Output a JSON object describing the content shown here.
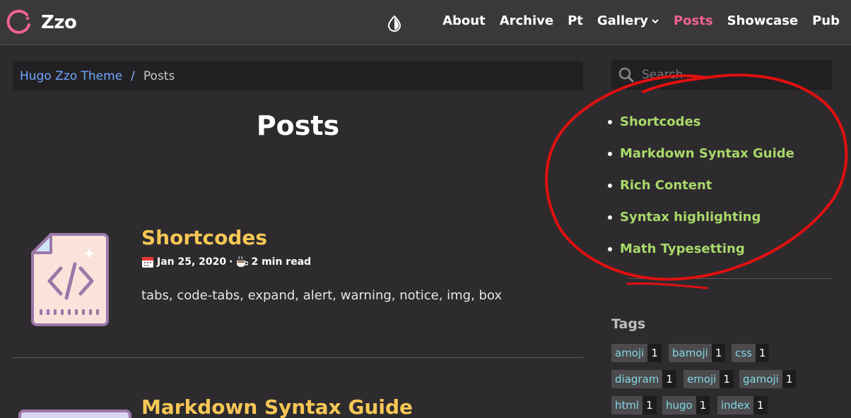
{
  "brand": {
    "name": "Zzo"
  },
  "nav": {
    "items": [
      {
        "label": "About",
        "active": false
      },
      {
        "label": "Archive",
        "active": false
      },
      {
        "label": "Pt",
        "active": false
      },
      {
        "label": "Gallery",
        "active": false,
        "dropdown": true
      },
      {
        "label": "Posts",
        "active": true
      },
      {
        "label": "Showcase",
        "active": false
      },
      {
        "label": "Pub",
        "active": false
      }
    ]
  },
  "breadcrumb": {
    "home": "Hugo Zzo Theme",
    "separator": "/",
    "current": "Posts"
  },
  "page": {
    "title": "Posts"
  },
  "posts": [
    {
      "title": "Shortcodes",
      "date": "Jan 25, 2020",
      "separator": "·",
      "read_time": "2 min read",
      "summary": "tabs, code-tabs, expand, alert, warning, notice, img, box",
      "icon": "code-file-icon"
    },
    {
      "title": "Markdown Syntax Guide",
      "icon": "document-icon"
    }
  ],
  "sidebar": {
    "search": {
      "placeholder": "Search"
    },
    "recent": [
      "Shortcodes",
      "Markdown Syntax Guide",
      "Rich Content",
      "Syntax highlighting",
      "Math Typesetting"
    ],
    "tags_heading": "Tags",
    "tags": [
      {
        "name": "amoji",
        "count": "1"
      },
      {
        "name": "bamoji",
        "count": "1"
      },
      {
        "name": "css",
        "count": "1"
      },
      {
        "name": "diagram",
        "count": "1"
      },
      {
        "name": "emoji",
        "count": "1"
      },
      {
        "name": "gamoji",
        "count": "1"
      },
      {
        "name": "html",
        "count": "1"
      },
      {
        "name": "hugo",
        "count": "1"
      },
      {
        "name": "index",
        "count": "1"
      }
    ]
  },
  "colors": {
    "background": "#2e2b2e",
    "navbar": "#3b383b",
    "active_nav": "#f06292",
    "post_title": "#f7c755",
    "recent_link": "#a8d96a",
    "tag_text": "#80d8e6",
    "annotation": "#e01010"
  }
}
